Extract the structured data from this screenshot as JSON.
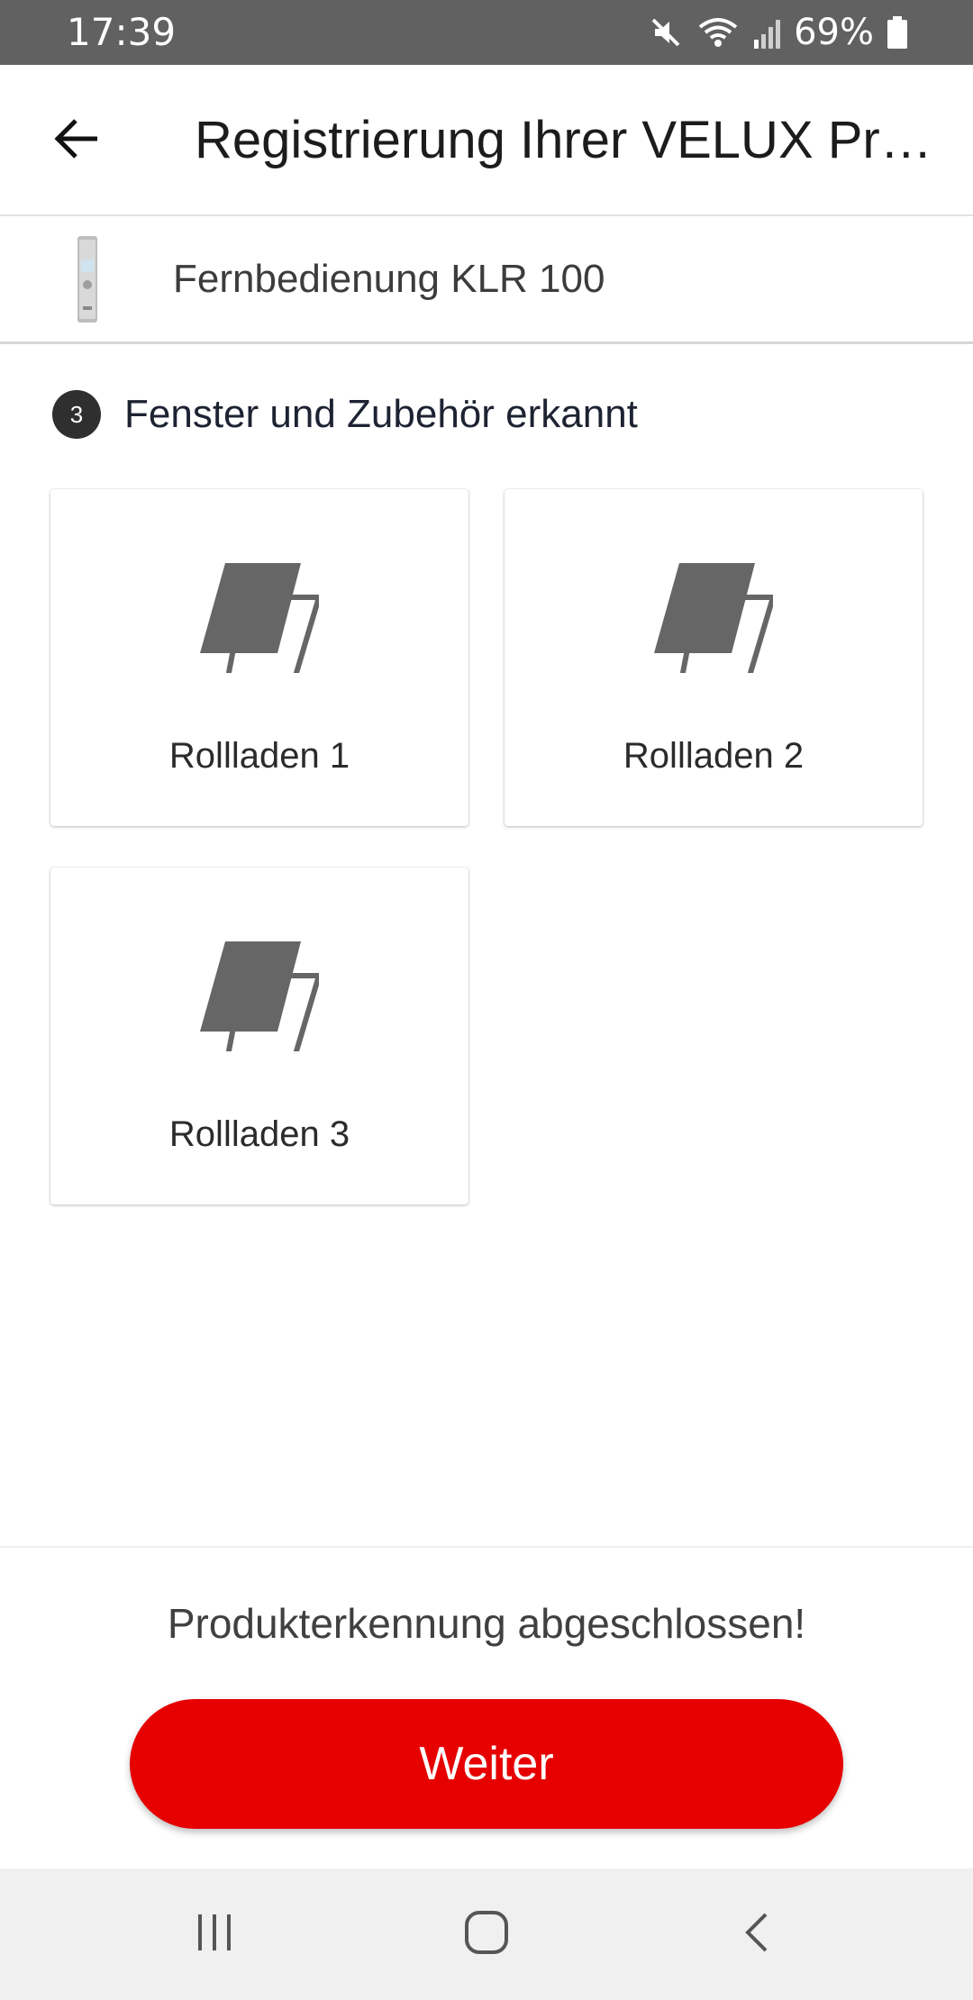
{
  "status_bar": {
    "time": "17:39",
    "battery": "69%",
    "icons": [
      "mute-icon",
      "wifi-icon",
      "signal-icon",
      "battery-icon"
    ]
  },
  "app_bar": {
    "title": "Registrierung Ihrer VELUX Produkte",
    "back_icon": "arrow-left-icon"
  },
  "product": {
    "name": "Fernbedienung KLR 100",
    "thumbnail_icon": "remote-control-icon"
  },
  "detected": {
    "count": "3",
    "label": "Fenster und Zubehör erkannt"
  },
  "devices": [
    {
      "label": "Rollladen 1",
      "icon": "roller-shutter-icon"
    },
    {
      "label": "Rollladen 2",
      "icon": "roller-shutter-icon"
    },
    {
      "label": "Rollladen 3",
      "icon": "roller-shutter-icon"
    }
  ],
  "footer": {
    "message": "Produkterkennung abgeschlossen!",
    "button_label": "Weiter"
  },
  "colors": {
    "accent": "#E60000",
    "status_bar": "#616161",
    "icon_gray": "#666666"
  }
}
